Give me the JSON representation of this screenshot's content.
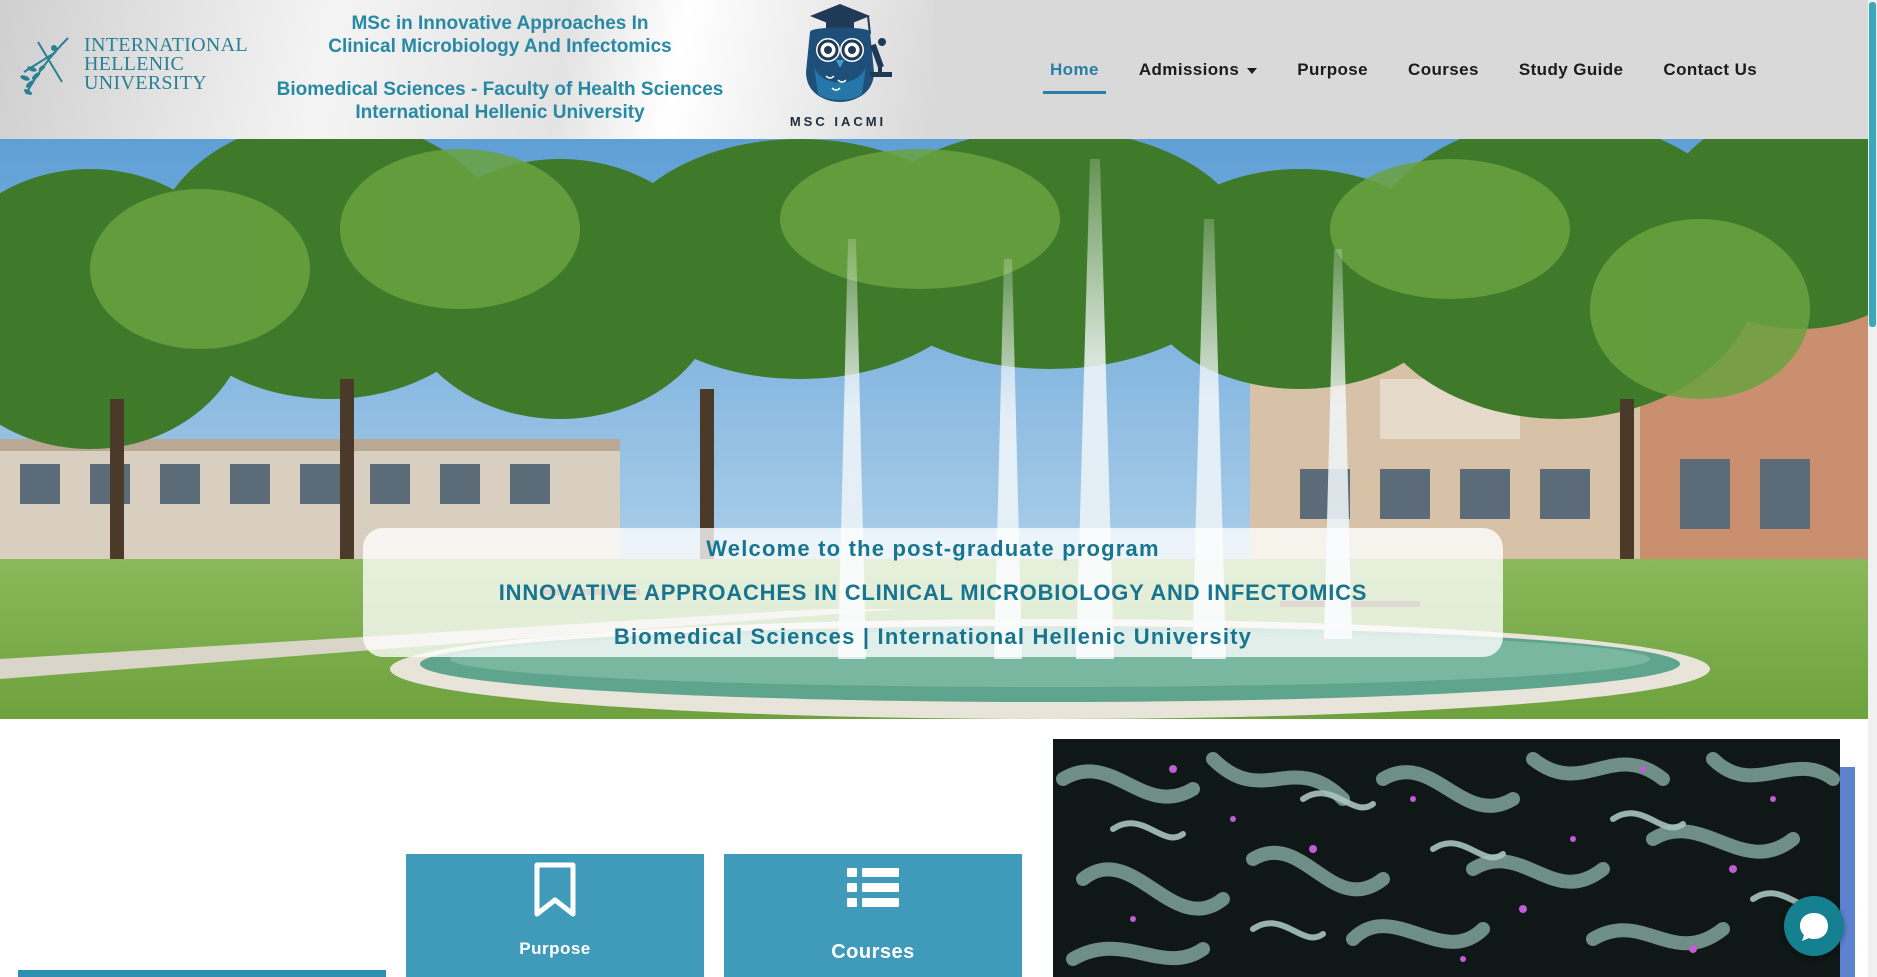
{
  "header": {
    "university_logo": {
      "lines": [
        "INTERNATIONAL",
        "HELLENIC",
        "UNIVERSITY"
      ],
      "icon": "ihu-olive-branch-logo-icon"
    },
    "program_title": {
      "line1": "MSc in Innovative Approaches In",
      "line2": "Clinical Microbiology And Infectomics",
      "line3": "Biomedical Sciences - Faculty of Health Sciences",
      "line4": "International Hellenic University"
    },
    "owl_logo": {
      "label": "MSC IACMI",
      "icon": "owl-graduate-microscope-logo-icon"
    }
  },
  "nav": {
    "items": [
      {
        "label": "Home",
        "active": true
      },
      {
        "label": "Admissions",
        "has_dropdown": true
      },
      {
        "label": "Purpose"
      },
      {
        "label": "Courses"
      },
      {
        "label": "Study Guide"
      },
      {
        "label": "Contact Us"
      }
    ]
  },
  "hero": {
    "line1": "Welcome to the post-graduate program",
    "line2": "INNOVATIVE APPROACHES IN CLINICAL MICROBIOLOGY AND INFECTOMICS",
    "line3": "Biomedical Sciences | International Hellenic University"
  },
  "cards": [
    {
      "label": "Purpose",
      "icon": "bookmark-icon"
    },
    {
      "label": "Courses",
      "icon": "list-icon"
    }
  ],
  "colors": {
    "header_bg": "#d9d9d9",
    "brand_teal": "#2789a4",
    "nav_active": "#2a7fa6",
    "card_bg": "#3f9bb9",
    "chat_bubble": "#15808f",
    "side_accent": "#5d82cf"
  },
  "chat_widget": {
    "icon": "chat-bubble-icon"
  }
}
